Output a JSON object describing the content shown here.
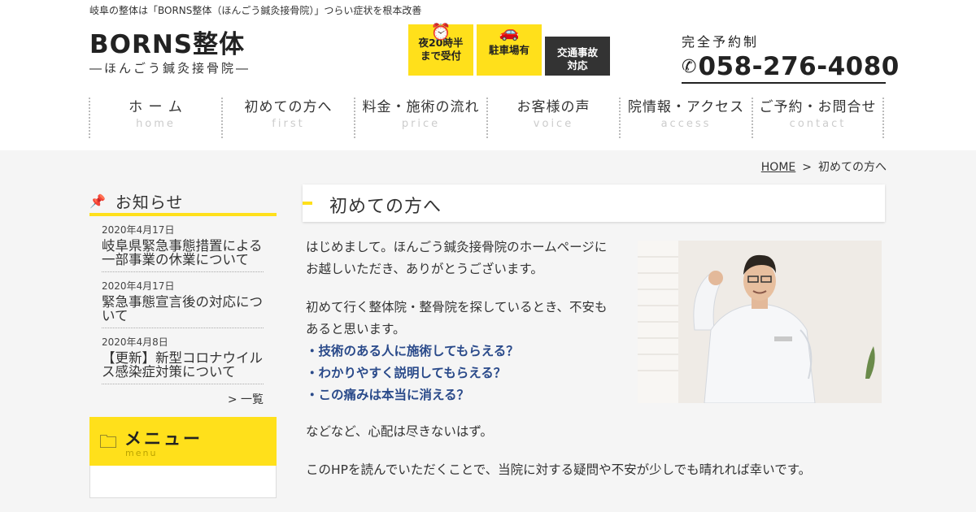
{
  "header": {
    "tagline": "岐阜の整体は「BORNS整体（ほんごう鍼灸接骨院）」つらい症状を根本改善",
    "logo_main": "BORNS整体",
    "logo_sub": "―ほんごう鍼灸接骨院―",
    "badges": [
      {
        "label": "夜20時半まで受付",
        "icon": "alarm-clock-icon",
        "bg": "#ffe01b"
      },
      {
        "label": "駐車場有",
        "icon": "car-icon",
        "bg": "#ffe01b"
      },
      {
        "label": "交通事故対応",
        "icon": "",
        "bg": "#333333"
      }
    ],
    "phone_label": "完全予約制",
    "phone_number": "058-276-4080"
  },
  "nav": [
    {
      "jp": "ホ ー ム",
      "en": "home"
    },
    {
      "jp": "初めての方へ",
      "en": "first"
    },
    {
      "jp": "料金・施術の流れ",
      "en": "price"
    },
    {
      "jp": "お客様の声",
      "en": "voice"
    },
    {
      "jp": "院情報・アクセス",
      "en": "access"
    },
    {
      "jp": "ご予約・お問合せ",
      "en": "contact"
    }
  ],
  "breadcrumb": {
    "home": "HOME",
    "separator": ">",
    "current": "初めての方へ"
  },
  "sidebar": {
    "news_title": "お知らせ",
    "news": [
      {
        "date": "2020年4月17日",
        "title": "岐阜県緊急事態措置による一部事業の休業について"
      },
      {
        "date": "2020年4月17日",
        "title": "緊急事態宣言後の対応について"
      },
      {
        "date": "2020年4月8日",
        "title": "【更新】新型コロナウイルス感染症対策について"
      }
    ],
    "news_more": "> 一覧",
    "menu_title": "メニュー",
    "menu_en": "menu"
  },
  "main": {
    "title": "初めての方へ",
    "p1": "はじめまして。ほんごう鍼灸接骨院のホームページにお越しいただき、ありがとうございます。",
    "p2": "初めて行く整体院・整骨院を探しているとき、不安もあると思います。",
    "highlights": [
      "・技術のある人に施術してもらえる？",
      "・わかりやすく説明してもらえる？",
      "・この痛みは本当に消える？"
    ],
    "p3": "などなど、心配は尽きないはず。",
    "p4": "このHPを読んでいただくことで、当院に対する疑問や不安が少しでも晴れれば幸いです。"
  },
  "colors": {
    "accent": "#ffe01b",
    "highlight_text": "#2a4a8a",
    "dark_badge": "#333333",
    "background_gray": "#f5f5f5"
  }
}
